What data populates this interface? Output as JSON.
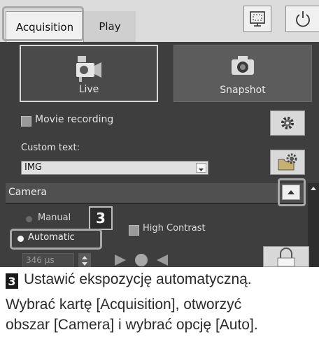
{
  "tabs": [
    {
      "label": "Acquisition",
      "active": true
    },
    {
      "label": "Play",
      "active": false
    }
  ],
  "toolbar": {
    "display_icon": "display-fit-icon",
    "power_icon": "power-icon"
  },
  "capture": {
    "live_label": "Live",
    "snapshot_label": "Snapshot"
  },
  "options": {
    "movie_recording_label": "Movie recording",
    "custom_text_label": "Custom text:",
    "custom_text_value": "IMG"
  },
  "camera": {
    "section_title": "Camera",
    "manual_label": "Manual",
    "automatic_label": "Automatic",
    "selected_mode": "Automatic",
    "high_contrast_label": "High Contrast",
    "exposure_value": "346 µs"
  },
  "step": {
    "number": "3",
    "title": "Ustawić ekspozycję automatyczną.",
    "line1": "Wybrać kartę [Acquisition], otworzyć",
    "line2": "obszar [Camera] i wybrać opcję [Auto]."
  },
  "colors": {
    "panel_bg": "#3e3e3e",
    "highlight": "#a8a8a8"
  }
}
